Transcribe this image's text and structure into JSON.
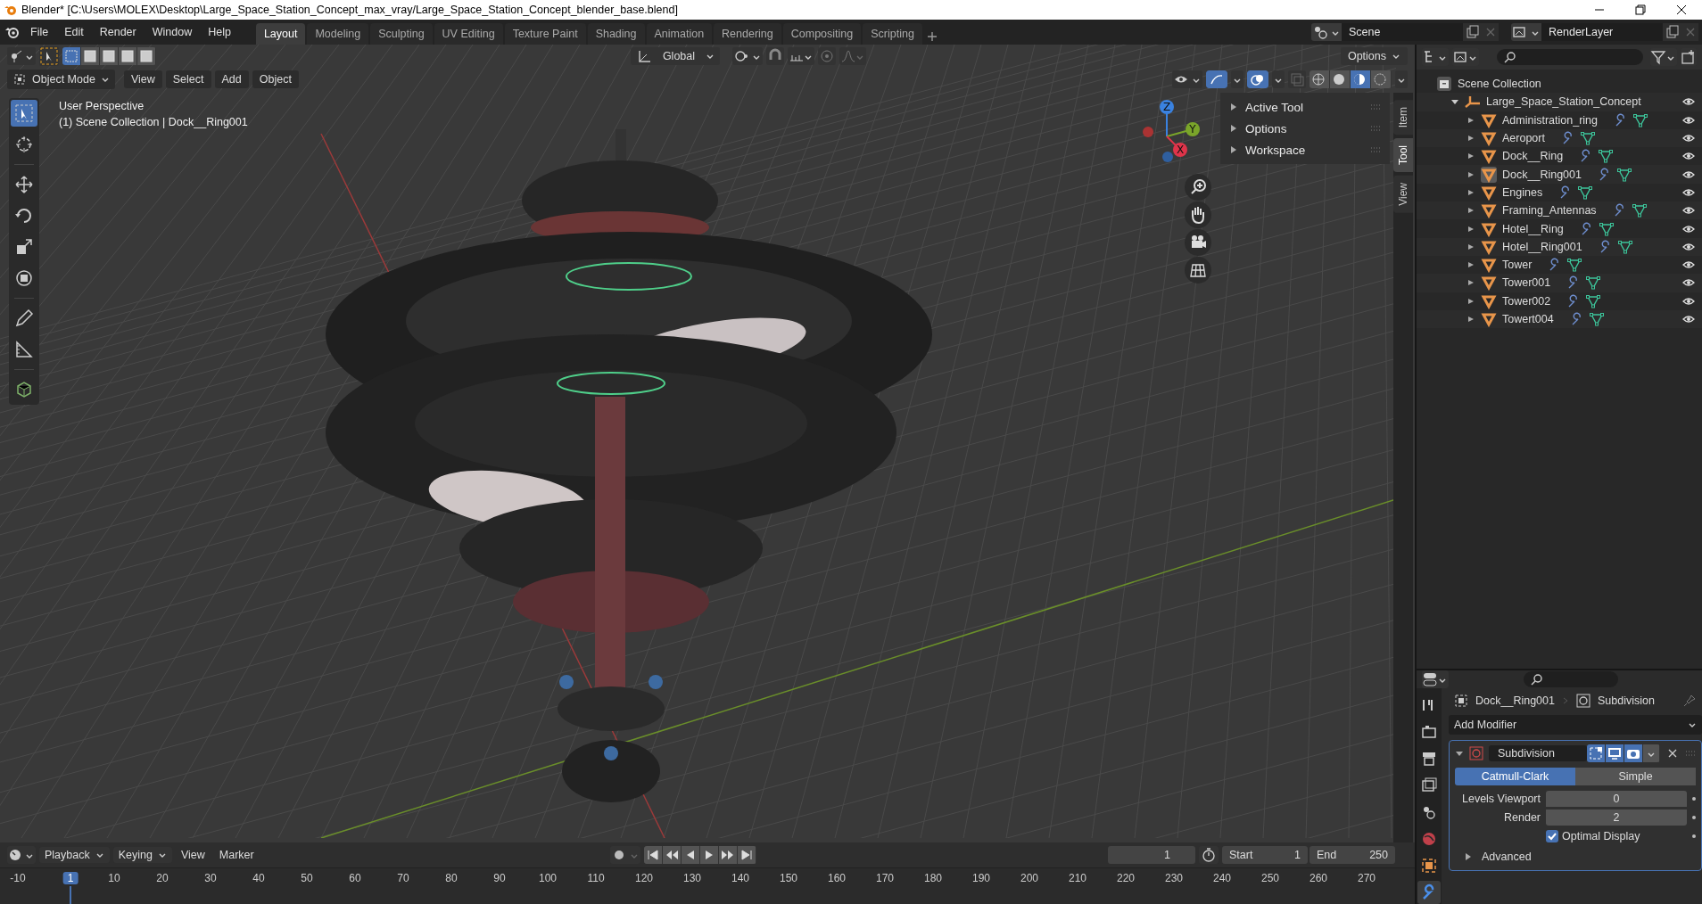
{
  "window": {
    "title": "Blender* [C:\\Users\\MOLEX\\Desktop\\Large_Space_Station_Concept_max_vray/Large_Space_Station_Concept_blender_base.blend]"
  },
  "menu": [
    "File",
    "Edit",
    "Render",
    "Window",
    "Help"
  ],
  "workspaces": [
    {
      "label": "Layout",
      "selected": true
    },
    {
      "label": "Modeling",
      "selected": false
    },
    {
      "label": "Sculpting",
      "selected": false
    },
    {
      "label": "UV Editing",
      "selected": false
    },
    {
      "label": "Texture Paint",
      "selected": false
    },
    {
      "label": "Shading",
      "selected": false
    },
    {
      "label": "Animation",
      "selected": false
    },
    {
      "label": "Rendering",
      "selected": false
    },
    {
      "label": "Compositing",
      "selected": false
    },
    {
      "label": "Scripting",
      "selected": false
    }
  ],
  "scene": {
    "name": "Scene"
  },
  "view_layer": {
    "name": "RenderLayer"
  },
  "tool_header": {
    "orientation": "Global",
    "options": "Options"
  },
  "viewport_header": {
    "mode": "Object Mode",
    "menus": [
      "View",
      "Select",
      "Add",
      "Object"
    ],
    "shading": [
      {
        "selected": false
      },
      {
        "selected": false
      },
      {
        "selected": true
      },
      {
        "selected": false
      }
    ]
  },
  "viewport": {
    "perspective": "User Perspective",
    "context": "(1) Scene Collection | Dock__Ring001",
    "axes": [
      "Z",
      "Y",
      "X"
    ]
  },
  "sidebar": {
    "panels": [
      {
        "label": "Active Tool",
        "expanded": false
      },
      {
        "label": "Options",
        "expanded": false
      },
      {
        "label": "Workspace",
        "expanded": false
      }
    ],
    "tabs": [
      {
        "label": "Item",
        "selected": false
      },
      {
        "label": "Tool",
        "selected": true
      },
      {
        "label": "View",
        "selected": false
      }
    ]
  },
  "outliner": {
    "root": "Scene Collection",
    "collection": {
      "label": "Large_Space_Station_Concept",
      "expanded": true,
      "children": [
        {
          "label": "Administration_ring",
          "active": false
        },
        {
          "label": "Aeroport",
          "active": false
        },
        {
          "label": "Dock__Ring",
          "active": false
        },
        {
          "label": "Dock__Ring001",
          "active": true
        },
        {
          "label": "Engines",
          "active": false
        },
        {
          "label": "Framing_Antennas",
          "active": false
        },
        {
          "label": "Hotel__Ring",
          "active": false
        },
        {
          "label": "Hotel__Ring001",
          "active": false
        },
        {
          "label": "Tower",
          "active": false
        },
        {
          "label": "Tower001",
          "active": false
        },
        {
          "label": "Tower002",
          "active": false
        },
        {
          "label": "Towert004",
          "active": false
        }
      ]
    }
  },
  "properties": {
    "object": "Dock__Ring001",
    "modifier_crumb": "Subdivision",
    "add_modifier": "Add Modifier",
    "modifier": {
      "name": "Subdivision",
      "expanded": true
    },
    "algorithms": [
      {
        "label": "Catmull-Clark",
        "selected": true
      },
      {
        "label": "Simple",
        "selected": false
      }
    ],
    "fields": [
      {
        "label": "Levels Viewport",
        "value": "0"
      },
      {
        "label": "Render",
        "value": "2"
      }
    ],
    "optimal_display": {
      "label": "Optimal Display",
      "checked": true
    },
    "advanced": {
      "label": "Advanced",
      "expanded": false
    }
  },
  "timeline": {
    "menus": [
      "Playback",
      "Keying",
      "View",
      "Marker"
    ],
    "current_frame": "1",
    "start_label": "Start",
    "start": "1",
    "end_label": "End",
    "end": "250",
    "ruler": [
      {
        "label": "-10",
        "selected": false
      },
      {
        "label": "1",
        "selected": true
      },
      {
        "label": "10",
        "selected": false
      },
      {
        "label": "20",
        "selected": false
      },
      {
        "label": "30",
        "selected": false
      },
      {
        "label": "40",
        "selected": false
      },
      {
        "label": "50",
        "selected": false
      },
      {
        "label": "60",
        "selected": false
      },
      {
        "label": "70",
        "selected": false
      },
      {
        "label": "80",
        "selected": false
      },
      {
        "label": "90",
        "selected": false
      },
      {
        "label": "100",
        "selected": false
      },
      {
        "label": "110",
        "selected": false
      },
      {
        "label": "120",
        "selected": false
      },
      {
        "label": "130",
        "selected": false
      },
      {
        "label": "140",
        "selected": false
      },
      {
        "label": "150",
        "selected": false
      },
      {
        "label": "160",
        "selected": false
      },
      {
        "label": "170",
        "selected": false
      },
      {
        "label": "180",
        "selected": false
      },
      {
        "label": "190",
        "selected": false
      },
      {
        "label": "200",
        "selected": false
      },
      {
        "label": "210",
        "selected": false
      },
      {
        "label": "220",
        "selected": false
      },
      {
        "label": "230",
        "selected": false
      },
      {
        "label": "240",
        "selected": false
      },
      {
        "label": "250",
        "selected": false
      },
      {
        "label": "260",
        "selected": false
      },
      {
        "label": "270",
        "selected": false
      }
    ]
  }
}
